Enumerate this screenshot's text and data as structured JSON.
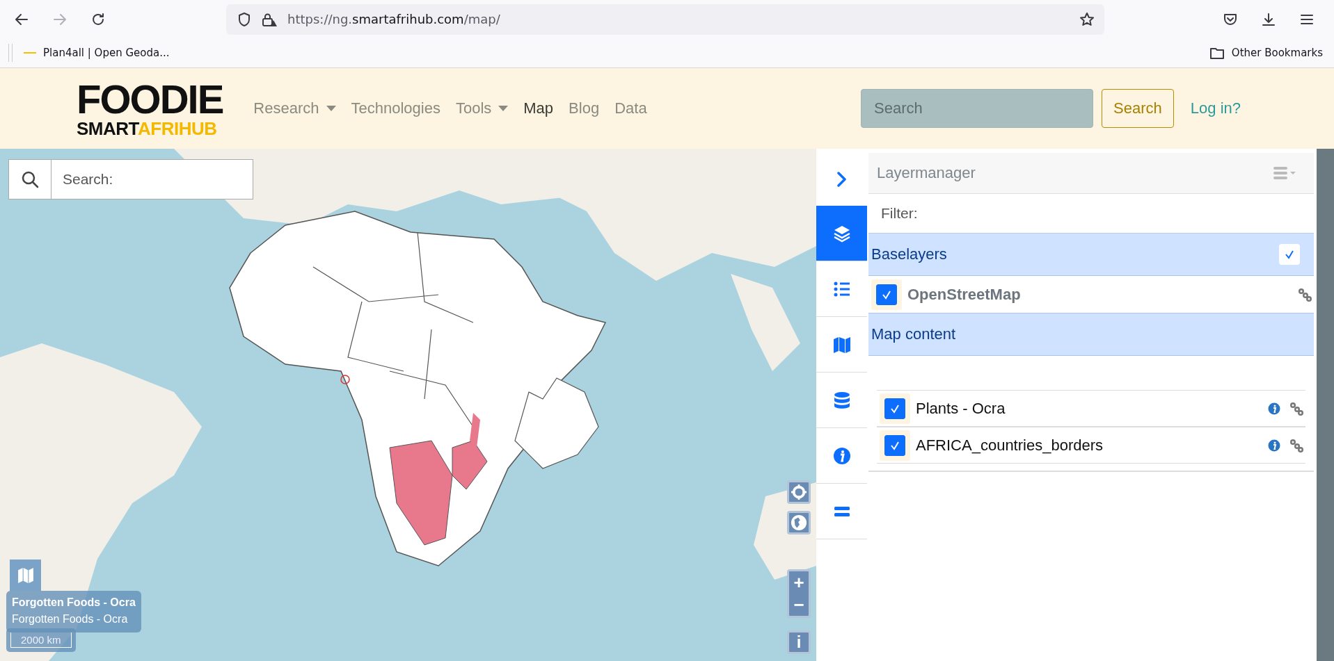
{
  "browser": {
    "url": {
      "prefix": "https://ng.",
      "domain": "smartafrihub.com",
      "path": "/map/"
    },
    "bookmarks": [
      {
        "label": "Plan4all | Open Geoda..."
      }
    ],
    "other_bookmarks": "Other Bookmarks"
  },
  "site": {
    "logo": {
      "top": "FOODIE",
      "bottom_left": "SMART",
      "bottom_right": "AFRIHUB"
    },
    "nav": [
      {
        "label": "Research",
        "dropdown": true,
        "selected": false
      },
      {
        "label": "Technologies",
        "dropdown": false,
        "selected": false
      },
      {
        "label": "Tools",
        "dropdown": true,
        "selected": false
      },
      {
        "label": "Map",
        "dropdown": false,
        "selected": true
      },
      {
        "label": "Blog",
        "dropdown": false,
        "selected": false
      },
      {
        "label": "Data",
        "dropdown": false,
        "selected": false
      }
    ],
    "search": {
      "placeholder": "Search"
    },
    "search_button": "Search",
    "login": "Log in?"
  },
  "map": {
    "kind": "picture",
    "search": {
      "placeholder": "Search:"
    },
    "legend": {
      "title": "Forgotten Foods - Ocra",
      "layer": "Forgotten Foods - Ocra"
    },
    "scale": "2000 km",
    "zoom_in": "+",
    "zoom_out": "−",
    "info": "i"
  },
  "sidebar": {
    "tabs": [
      {
        "kind": "collapse",
        "selected": false
      },
      {
        "kind": "layers",
        "selected": true
      },
      {
        "kind": "list",
        "selected": false
      },
      {
        "kind": "map",
        "selected": false
      },
      {
        "kind": "database",
        "selected": false
      },
      {
        "kind": "info",
        "selected": false
      },
      {
        "kind": "more",
        "selected": false
      }
    ],
    "panel": {
      "title": "Layermanager",
      "filter": {
        "placeholder": "Filter:"
      },
      "groups": [
        {
          "kind": "base",
          "title": "Baselayers",
          "checked": true,
          "layers": [
            {
              "name": "OpenStreetMap",
              "checked": true
            }
          ]
        },
        {
          "kind": "content",
          "title": "Map content",
          "layers": [
            {
              "name": "Plants - Ocra",
              "checked": true
            },
            {
              "name": "AFRICA_countries_borders",
              "checked": true
            }
          ]
        }
      ]
    }
  }
}
